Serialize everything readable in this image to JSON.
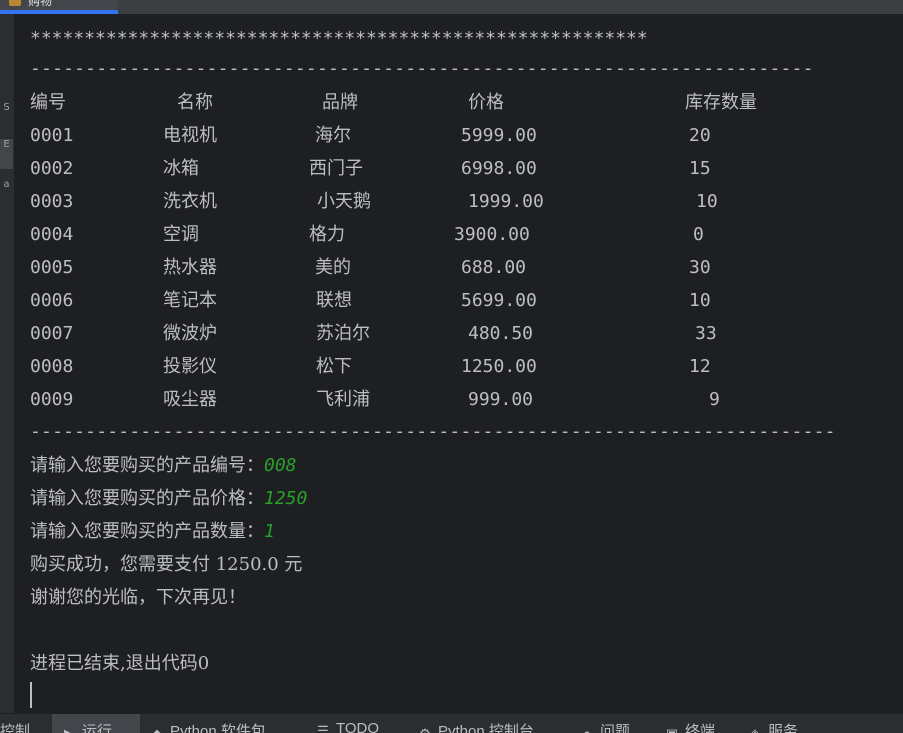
{
  "tab": {
    "title": "购物"
  },
  "sidebar": {
    "items": [
      "S",
      "E",
      "a"
    ]
  },
  "console": {
    "stars": "*********************************************************",
    "separator_short": "-----------------------------------------------------------------------",
    "separator_long": "-------------------------------------------------------------------------",
    "headers": [
      "编号",
      "名称",
      "品牌",
      "价格",
      "库存数量"
    ],
    "rows": [
      [
        "0001",
        "电视机",
        "海尔",
        "5999.00",
        "20"
      ],
      [
        "0002",
        "冰箱",
        "西门子",
        "6998.00",
        "15"
      ],
      [
        "0003",
        "洗衣机",
        "小天鹅",
        "1999.00",
        "10"
      ],
      [
        "0004",
        "空调",
        "格力",
        "3900.00",
        "0"
      ],
      [
        "0005",
        "热水器",
        "美的",
        "688.00",
        "30"
      ],
      [
        "0006",
        "笔记本",
        "联想",
        "5699.00",
        "10"
      ],
      [
        "0007",
        "微波炉",
        "苏泊尔",
        "480.50",
        "33"
      ],
      [
        "0008",
        "投影仪",
        "松下",
        "1250.00",
        "12"
      ],
      [
        "0009",
        "吸尘器",
        "飞利浦",
        "999.00",
        "9"
      ]
    ],
    "prompt_id": "请输入您要购买的产品编号：",
    "input_id": "008",
    "prompt_price": "请输入您要购买的产品价格：",
    "input_price": "1250",
    "prompt_qty": "请输入您要购买的产品数量：",
    "input_qty": "1",
    "success": "购买成功，您需要支付 1250.0 元",
    "thanks": "谢谢您的光临，下次再见！",
    "exit": "进程已结束,退出代码0"
  },
  "bottom_tabs": [
    {
      "label": "控制",
      "icon": "console-icon"
    },
    {
      "label": "运行",
      "icon": "run-icon"
    },
    {
      "label": "Python 软件包",
      "icon": "packages-icon"
    },
    {
      "label": "TODO",
      "icon": "todo-icon"
    },
    {
      "label": "Python 控制台",
      "icon": "python-console-icon"
    },
    {
      "label": "问题",
      "icon": "problems-icon"
    },
    {
      "label": "终端",
      "icon": "terminal-icon"
    },
    {
      "label": "服务",
      "icon": "services-icon"
    }
  ],
  "colors": {
    "accent": "#3574f0",
    "input_text": "#2aa02a",
    "console_bg": "#1e1f22"
  }
}
